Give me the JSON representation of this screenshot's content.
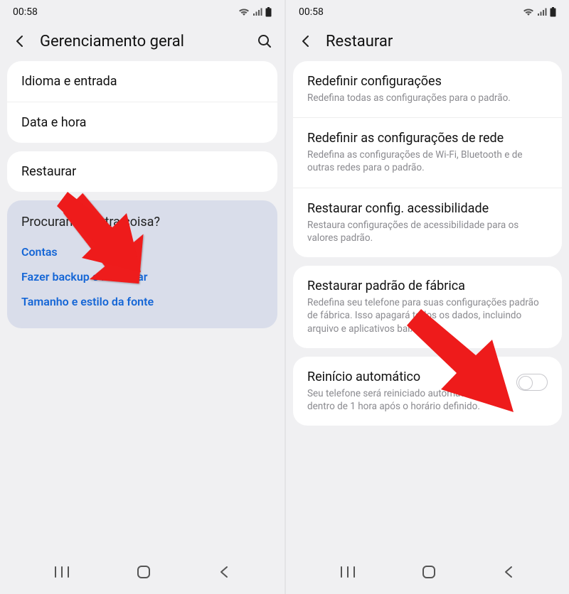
{
  "colors": {
    "accent": "#1566d6",
    "gray": "#8a8a8f",
    "cardBg": "#ffffff",
    "pageBg": "#f0f0f2",
    "suggestBg": "#d9ddea",
    "arrow": "#ee1b1b"
  },
  "statusbar": {
    "time": "00:58"
  },
  "left": {
    "header": {
      "title": "Gerenciamento geral"
    },
    "group1": {
      "row1": "Idioma e entrada",
      "row2": "Data e hora"
    },
    "group2": {
      "row1": "Restaurar"
    },
    "suggest": {
      "question": "Procurando outra coisa?",
      "links": [
        {
          "label": "Contas"
        },
        {
          "label": "Fazer backup e restaurar"
        },
        {
          "label": "Tamanho e estilo da fonte"
        }
      ]
    }
  },
  "right": {
    "header": {
      "title": "Restaurar"
    },
    "group1": {
      "rows": [
        {
          "title": "Redefinir configurações",
          "sub": "Redefina todas as configurações para o padrão."
        },
        {
          "title": "Redefinir as configurações de rede",
          "sub": "Redefina as configurações de Wi-Fi, Bluetooth e de outras redes para o padrão."
        },
        {
          "title": "Restaurar config. acessibilidade",
          "sub": "Restaura configurações de acessibilidade para os valores padrão."
        }
      ]
    },
    "group2": {
      "rows": [
        {
          "title": "Restaurar padrão de fábrica",
          "sub": "Redefina seu telefone para suas configurações padrão de fábrica. Isso apagará todos os dados, incluindo arquivo e aplicativos baixados."
        }
      ]
    },
    "group3": {
      "rows": [
        {
          "title": "Reinício automático",
          "sub": "Seu telefone será reiniciado automaticamente dentro de 1 hora após o horário definido."
        }
      ]
    }
  }
}
